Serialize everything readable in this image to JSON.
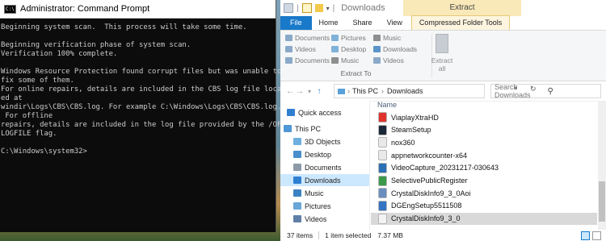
{
  "cmd": {
    "icon_text": "C:\\",
    "title": "Administrator: Command Prompt",
    "lines": [
      "Beginning system scan.  This process will take some time.",
      "",
      "Beginning verification phase of system scan.",
      "Verification 100% complete.",
      "",
      "Windows Resource Protection found corrupt files but was unable to",
      "fix some of them.",
      "For online repairs, details are included in the CBS log file locat",
      "ed at",
      "windir\\Logs\\CBS\\CBS.log. For example C:\\Windows\\Logs\\CBS\\CBS.log.",
      " For offline",
      "repairs, details are included in the log file provided by the /OFF",
      "LOGFILE flag.",
      "",
      "C:\\Windows\\system32>"
    ]
  },
  "explorer": {
    "title": "Downloads",
    "context_group": "Extract",
    "tabs": [
      "File",
      "Home",
      "Share",
      "View",
      "Compressed Folder Tools"
    ],
    "ribbon": {
      "destinations": [
        {
          "label": "Documents",
          "icon": "documents-icon",
          "color": "#8aa9c9"
        },
        {
          "label": "Pictures",
          "icon": "pictures-icon",
          "color": "#7fb2d9"
        },
        {
          "label": "Music",
          "icon": "music-icon",
          "color": "#8e8e8e"
        },
        {
          "label": "Videos",
          "icon": "videos-icon",
          "color": "#8aa9c9"
        },
        {
          "label": "Desktop",
          "icon": "desktop-icon",
          "color": "#7fb2d9"
        },
        {
          "label": "Downloads",
          "icon": "downloads-icon",
          "color": "#5b94c8"
        },
        {
          "label": "Documents",
          "icon": "documents-icon",
          "color": "#8aa9c9"
        },
        {
          "label": "Music",
          "icon": "music-icon",
          "color": "#8e8e8e"
        },
        {
          "label": "Videos",
          "icon": "videos-icon",
          "color": "#8aa9c9"
        }
      ],
      "group_label": "Extract To",
      "extract_all": "Extract all"
    },
    "breadcrumb": [
      "This PC",
      "Downloads"
    ],
    "search_placeholder": "Search Downloads",
    "nav_items": [
      {
        "label": "Quick access",
        "icon": "star-icon",
        "color": "#2f7fd1"
      },
      {
        "label": "This PC",
        "icon": "computer-icon",
        "color": "#4f97d6"
      },
      {
        "label": "3D Objects",
        "icon": "cube-icon",
        "color": "#6db0e0"
      },
      {
        "label": "Desktop",
        "icon": "desktop-icon",
        "color": "#4a8fcc"
      },
      {
        "label": "Documents",
        "icon": "documents-icon",
        "color": "#8c9aa8"
      },
      {
        "label": "Downloads",
        "icon": "download-arrow-icon",
        "color": "#2f7fd1"
      },
      {
        "label": "Music",
        "icon": "music-note-icon",
        "color": "#3b82c4"
      },
      {
        "label": "Pictures",
        "icon": "pictures-icon",
        "color": "#6aa6d8"
      },
      {
        "label": "Videos",
        "icon": "film-icon",
        "color": "#5f7fa8"
      }
    ],
    "column_name": "Name",
    "files": [
      {
        "name": "ViaplayXtraHD",
        "icon": "viaplay-icon",
        "color": "#e0332e"
      },
      {
        "name": "SteamSetup",
        "icon": "steam-icon",
        "color": "#1b2838"
      },
      {
        "name": "nox360",
        "icon": "file-icon",
        "color": "#e9e9e9"
      },
      {
        "name": "appnetworkcounter-x64",
        "icon": "file-icon",
        "color": "#e9e9e9"
      },
      {
        "name": "VideoCapture_20231217-030643",
        "icon": "video-file-icon",
        "color": "#2b6fb5"
      },
      {
        "name": "SelectivePublicRegister",
        "icon": "app-icon",
        "color": "#3a9a4a"
      },
      {
        "name": "CrystalDiskInfo9_3_0Aoi",
        "icon": "disk-icon",
        "color": "#6a8fbf"
      },
      {
        "name": "DGEngSetup5511508",
        "icon": "setup-icon",
        "color": "#3474c2"
      },
      {
        "name": "CrystalDiskInfo9_3_0",
        "icon": "zip-file-icon",
        "color": "#f3f3f3"
      }
    ],
    "status": {
      "items": "37 items",
      "selected": "1 item selected",
      "size": "7.37 MB"
    }
  }
}
